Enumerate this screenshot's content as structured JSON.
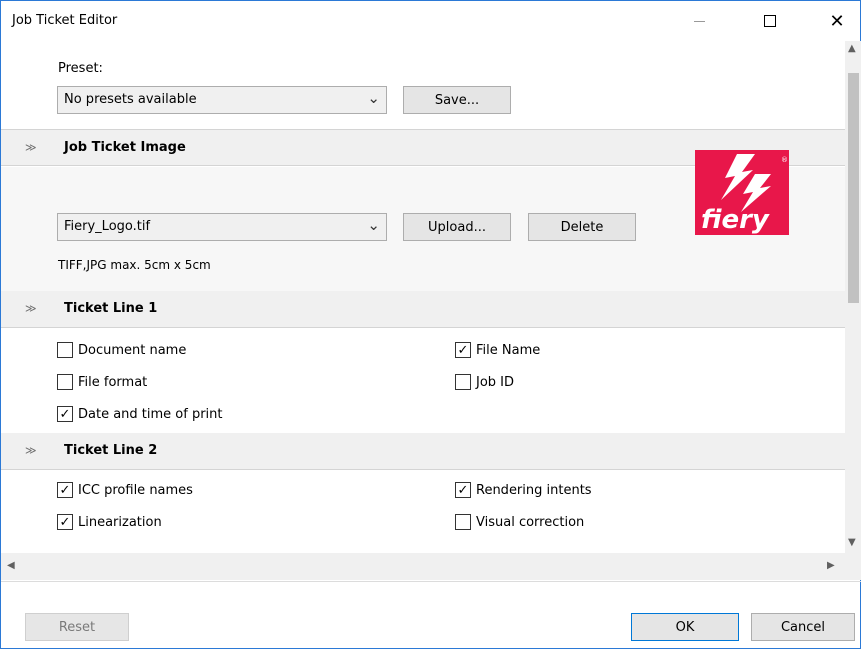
{
  "window": {
    "title": "Job Ticket Editor"
  },
  "preset": {
    "label": "Preset:",
    "select_value": "No presets available",
    "save_label": "Save..."
  },
  "image_section": {
    "title": "Job Ticket Image",
    "select_value": "Fiery_Logo.tif",
    "upload_label": "Upload...",
    "delete_label": "Delete",
    "hint": "TIFF,JPG  max. 5cm x 5cm",
    "logo_text": "fiery",
    "logo_mark": "®"
  },
  "ticket_line_1": {
    "title": "Ticket Line 1",
    "items": [
      {
        "label": "Document name",
        "checked": false
      },
      {
        "label": "File Name",
        "checked": true
      },
      {
        "label": "File format",
        "checked": false
      },
      {
        "label": "Job ID",
        "checked": false
      },
      {
        "label": "Date and time of print",
        "checked": true
      }
    ]
  },
  "ticket_line_2": {
    "title": "Ticket Line 2",
    "items": [
      {
        "label": "ICC profile names",
        "checked": true
      },
      {
        "label": "Rendering intents",
        "checked": true
      },
      {
        "label": "Linearization",
        "checked": true
      },
      {
        "label": "Visual correction",
        "checked": false
      }
    ]
  },
  "footer": {
    "reset_label": "Reset",
    "ok_label": "OK",
    "cancel_label": "Cancel"
  },
  "colors": {
    "accent": "#0078d7",
    "logo_red": "#e8174a"
  }
}
